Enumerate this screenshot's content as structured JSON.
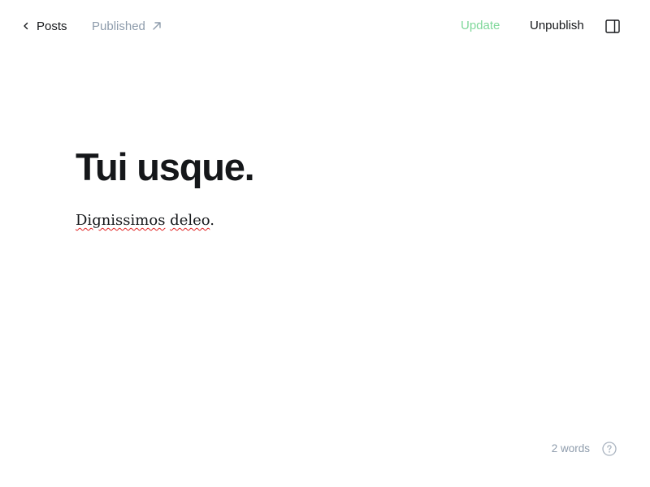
{
  "header": {
    "back_label": "Posts",
    "status_label": "Published",
    "update_label": "Update",
    "unpublish_label": "Unpublish"
  },
  "editor": {
    "title": "Tui usque.",
    "body_words": [
      "Dignissimos",
      "deleo"
    ],
    "body_end": "."
  },
  "footer": {
    "word_count": "2 words"
  },
  "colors": {
    "text": "#15171a",
    "muted": "#8e9cac",
    "update_accent": "#7fd89a",
    "spellcheck": "#e02424"
  },
  "icons": {
    "back": "chevron-left-icon",
    "status": "external-link-arrow-icon",
    "sidebar": "sidebar-toggle-icon",
    "help": "help-question-icon"
  }
}
